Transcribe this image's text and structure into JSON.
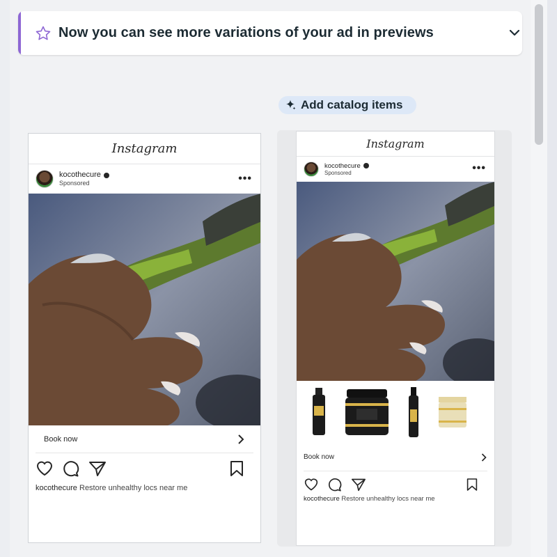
{
  "banner": {
    "title": "Now you can see more variations of your ad in previews",
    "accent_color": "#8e67d4",
    "icon": "star-icon",
    "toggle_icon": "chevron-down-icon"
  },
  "catalog_button": {
    "label": "Add catalog items",
    "icon": "sparkle-icon"
  },
  "previews": [
    {
      "platform": "Instagram",
      "username": "kocothecure",
      "sponsored": "Sponsored",
      "cta": "Book now",
      "caption_user": "kocothecure",
      "caption_text": "Restore unhealthy locs near me"
    },
    {
      "platform": "Instagram",
      "username": "kocothecure",
      "sponsored": "Sponsored",
      "cta": "Book now",
      "caption_user": "kocothecure",
      "caption_text": "Restore unhealthy locs near me",
      "catalog_products": [
        "foam-bottle",
        "jar",
        "spray-bottle",
        "jar-small"
      ]
    }
  ]
}
